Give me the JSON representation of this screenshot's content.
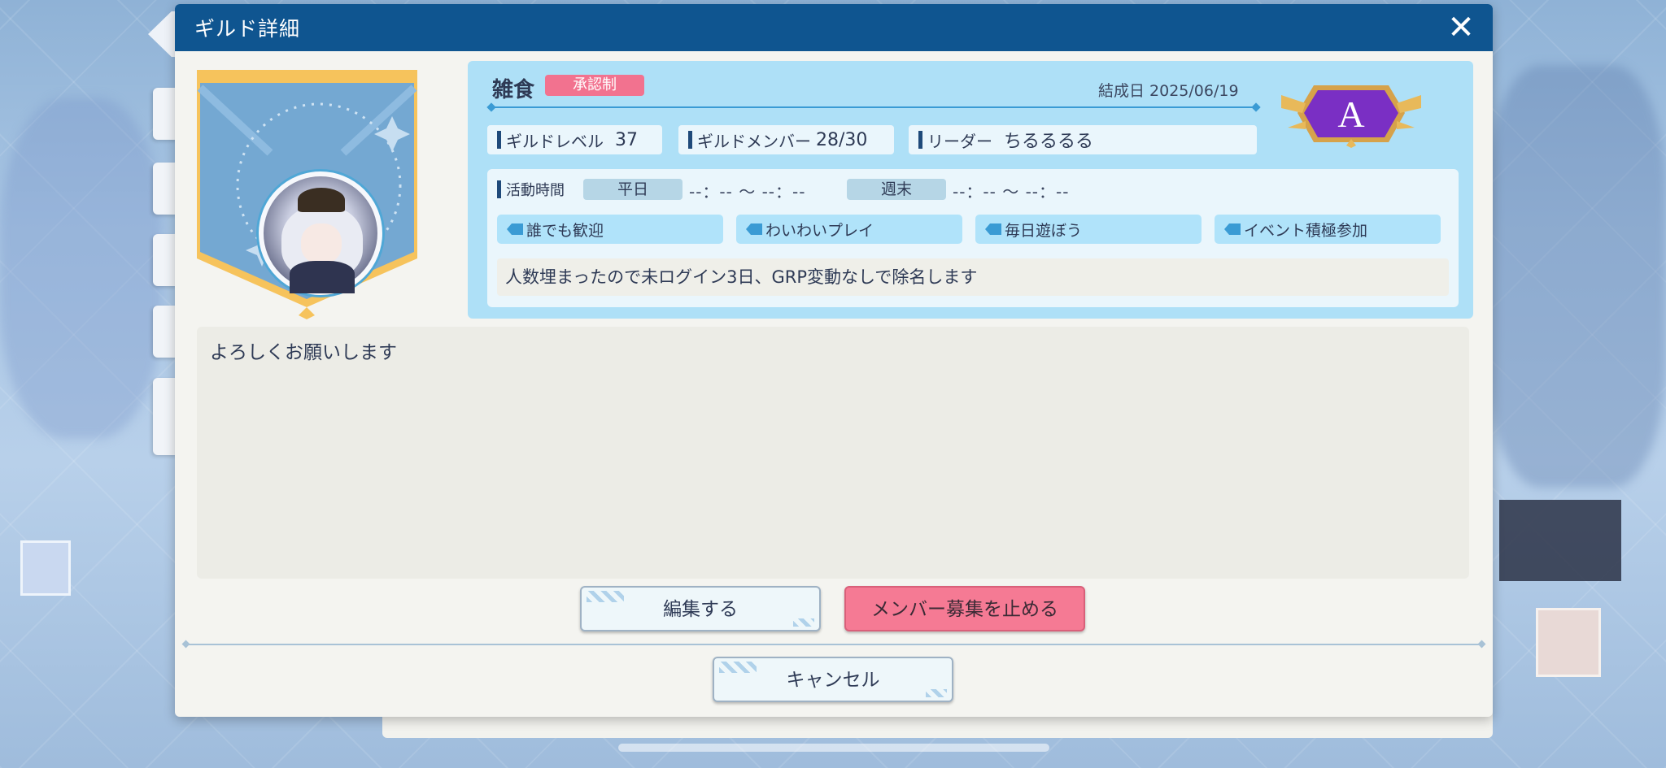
{
  "dialog": {
    "title": "ギルド詳細",
    "close_label": "✕"
  },
  "guild": {
    "name": "雑食",
    "join_type": "承認制",
    "founded": "結成日 2025/06/19",
    "rank": "A",
    "level_label": "ギルドレベル",
    "level_value": "37",
    "members_label": "ギルドメンバー",
    "members_value": "28/30",
    "leader_label": "リーダー",
    "leader_value": "ちるるるる"
  },
  "activity": {
    "label": "活動時間",
    "weekday_label": "平日",
    "weekday_range": "--：--  〜  --：--",
    "weekend_label": "週末",
    "weekend_range": "--：--  〜  --：--"
  },
  "tags": [
    "誰でも歓迎",
    "わいわいプレイ",
    "毎日遊ぼう",
    "イベント積極参加"
  ],
  "rule_note": "人数埋まったので未ログイン3日、GRP変動なしで除名します",
  "description": "よろしくお願いします",
  "buttons": {
    "edit": "編集する",
    "stop_recruit": "メンバー募集を止める",
    "cancel": "キャンセル"
  },
  "colors": {
    "header": "#0f5590",
    "info_panel": "#aee0f7",
    "badge": "#f2728f",
    "stop_button": "#f57a94",
    "rank_emblem": "#7a2fc4"
  },
  "icons": {
    "close": "close-icon",
    "tag": "tag-icon",
    "back": "back-arrow-icon"
  }
}
